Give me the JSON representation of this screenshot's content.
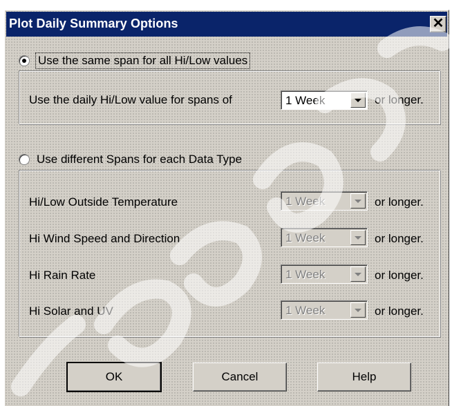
{
  "dialog": {
    "title": "Plot Daily Summary Options",
    "close_glyph": "✕"
  },
  "option_same": {
    "label": "Use the same span for all Hi/Low values",
    "checked": true,
    "row_label": "Use the daily Hi/Low value for spans of",
    "value": "1 Week",
    "suffix": "or longer."
  },
  "option_different": {
    "label": "Use different Spans for each Data Type",
    "checked": false,
    "rows": [
      {
        "label": "Hi/Low Outside Temperature",
        "value": "1 Week",
        "suffix": "or longer."
      },
      {
        "label": "Hi Wind Speed and Direction",
        "value": "1 Week",
        "suffix": "or longer."
      },
      {
        "label": "Hi Rain Rate",
        "value": "1 Week",
        "suffix": "or longer."
      },
      {
        "label": "Hi Solar and UV",
        "value": "1 Week",
        "suffix": "or longer."
      }
    ]
  },
  "buttons": {
    "ok": "OK",
    "cancel": "Cancel",
    "help": "Help"
  },
  "colors": {
    "titlebar": "#0a246a",
    "face": "#d4d0c8"
  }
}
